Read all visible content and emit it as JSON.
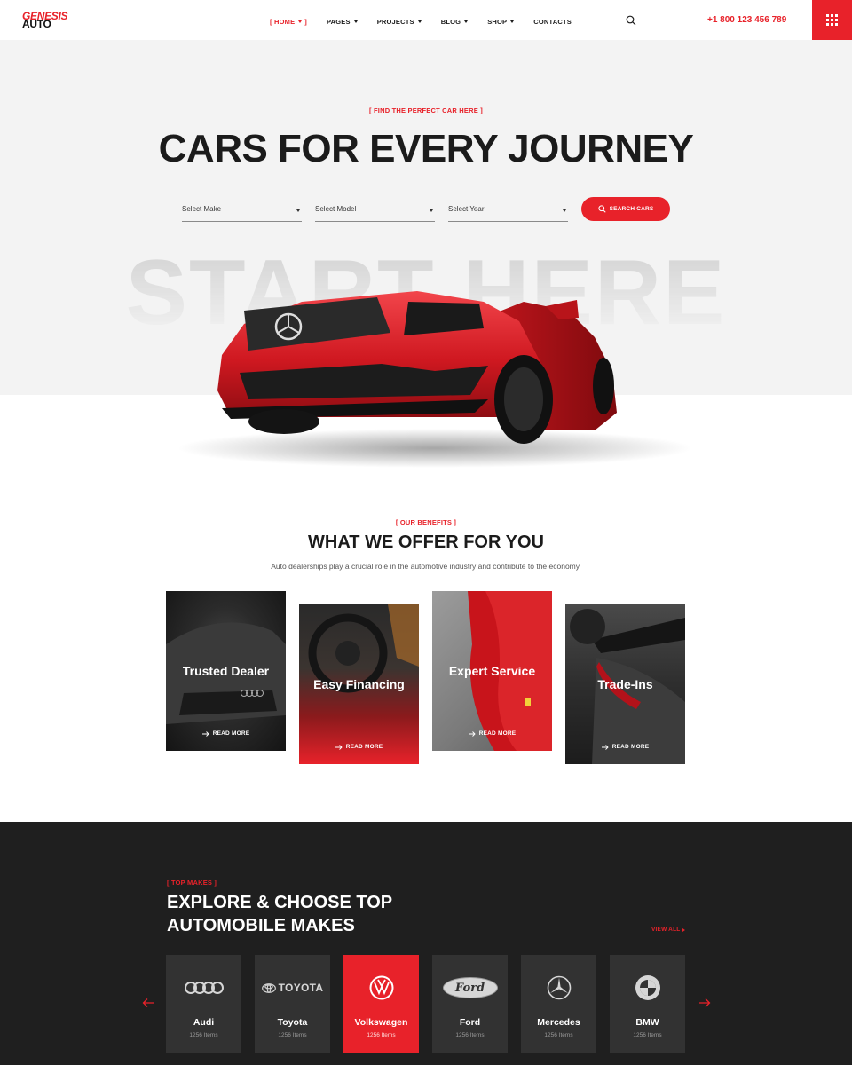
{
  "header": {
    "logo_top": "GENESIS",
    "logo_bottom": "AUTO",
    "nav": [
      {
        "label": "[ HOME",
        "suffix": "]",
        "active": true,
        "has_caret": true
      },
      {
        "label": "PAGES",
        "has_caret": true
      },
      {
        "label": "PROJECTS",
        "has_caret": true
      },
      {
        "label": "BLOG",
        "has_caret": true
      },
      {
        "label": "SHOP",
        "has_caret": true
      },
      {
        "label": "CONTACTS",
        "has_caret": false
      }
    ],
    "search_icon": "search-icon",
    "phone": "+1 800 123 456 789",
    "menu_icon": "grid-menu-icon"
  },
  "hero": {
    "kicker": "[ FIND THE PERFECT CAR HERE ]",
    "title": "CARS FOR EVERY JOURNEY",
    "selects": [
      {
        "placeholder": "Select Make"
      },
      {
        "placeholder": "Select Model"
      },
      {
        "placeholder": "Select Year"
      }
    ],
    "search_button": "SEARCH CARS",
    "background_word": "START HERE"
  },
  "benefits": {
    "kicker": "[ OUR BENEFITS ]",
    "title": "WHAT WE OFFER FOR YOU",
    "subtitle": "Auto dealerships play a crucial role in the automotive industry and contribute to the economy.",
    "cards": [
      {
        "title": "Trusted Dealer",
        "more": "READ MORE"
      },
      {
        "title": "Easy Financing",
        "more": "READ MORE"
      },
      {
        "title": "Expert Service",
        "more": "READ MORE"
      },
      {
        "title": "Trade-Ins",
        "more": "READ MORE"
      }
    ]
  },
  "makes": {
    "kicker": "[ TOP MAKES ]",
    "title": "EXPLORE & CHOOSE TOP AUTOMOBILE MAKES",
    "view_all": "VIEW ALL",
    "items": [
      {
        "name": "Audi",
        "count": "1256 Items",
        "icon": "audi-logo-icon"
      },
      {
        "name": "Toyota",
        "count": "1256 Items",
        "icon": "toyota-logo-icon",
        "logo_text": "TOYOTA"
      },
      {
        "name": "Volkswagen",
        "count": "1256 Items",
        "icon": "volkswagen-logo-icon",
        "active": true
      },
      {
        "name": "Ford",
        "count": "1256 Items",
        "icon": "ford-logo-icon",
        "logo_text": "Ford"
      },
      {
        "name": "Mercedes",
        "count": "1256 Items",
        "icon": "mercedes-logo-icon"
      },
      {
        "name": "BMW",
        "count": "1256 Items",
        "icon": "bmw-logo-icon"
      }
    ]
  },
  "colors": {
    "accent": "#e8222a",
    "dark": "#1f1f1f",
    "card": "#323232",
    "hero_bg": "#f3f3f3"
  }
}
